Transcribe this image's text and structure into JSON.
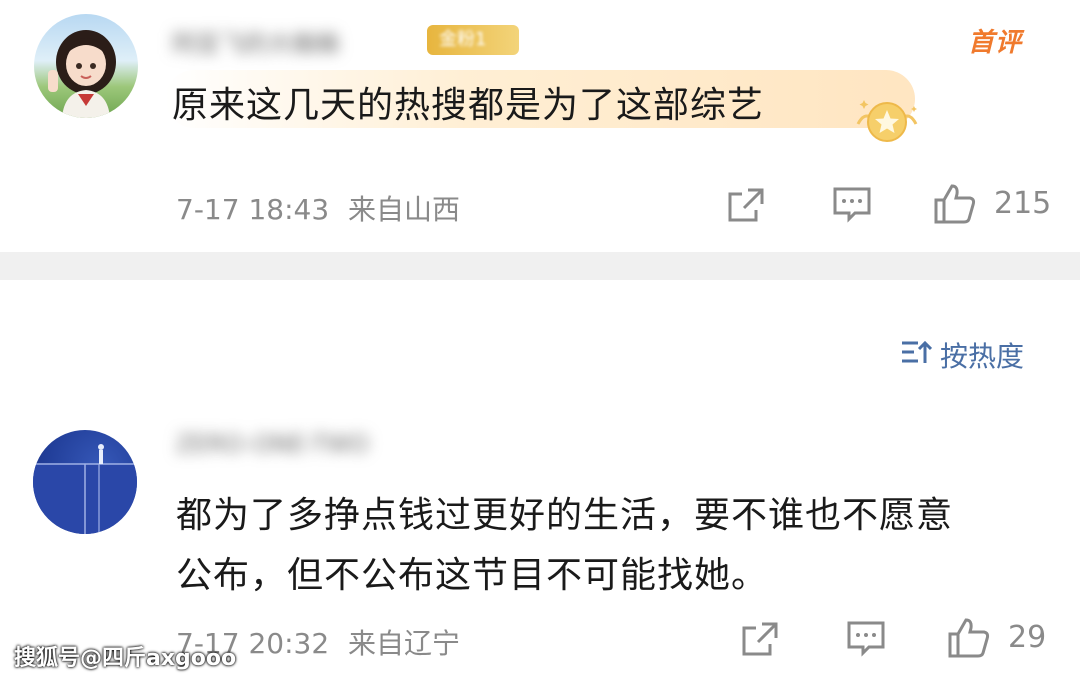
{
  "comments": [
    {
      "username": "阿亚飞的大蜘蛛",
      "badge": "金粉1",
      "tag": "首评",
      "text": "原来这几天的热搜都是为了这部综艺",
      "time": "7-17 18:43",
      "location": "来自山西",
      "likes": "215",
      "icons": {
        "share": "share-icon",
        "comment": "comment-icon",
        "like": "thumbs-up-icon",
        "medal": "star-medal-icon"
      }
    },
    {
      "username": "ZERO-ONE-TWO",
      "text_line1": "都为了多挣点钱过更好的生活，要不谁也不愿意",
      "text_line2": "公布，但不公布这节目不可能找她。",
      "time": "7-17 20:32",
      "location": "来自辽宁",
      "likes": "29",
      "icons": {
        "share": "share-icon",
        "comment": "comment-icon",
        "like": "thumbs-up-icon"
      }
    }
  ],
  "sort": {
    "label": "按热度",
    "icon": "sort-icon"
  },
  "watermark": "搜狐号@四斤axgooo",
  "colors": {
    "accent_blue": "#4a6fa5",
    "first_review_orange": "#f07a2d",
    "badge_gold": "#e7b53e",
    "meta_gray": "#8a8a8a"
  }
}
